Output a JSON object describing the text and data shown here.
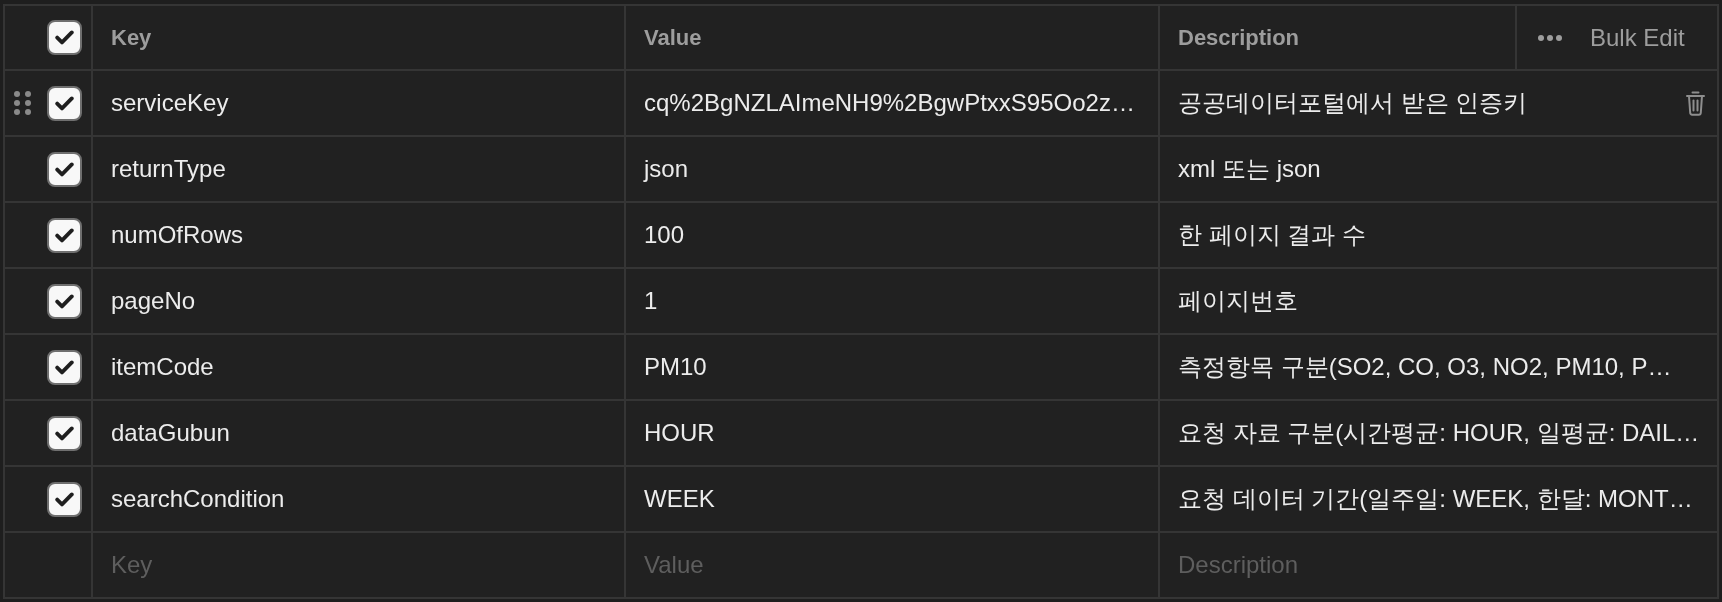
{
  "header": {
    "checkbox": {
      "checked": true
    },
    "columns": [
      "Key",
      "Value",
      "Description"
    ],
    "bulk_edit": "Bulk Edit"
  },
  "rows": [
    {
      "checked": true,
      "hovered": true,
      "key": "serviceKey",
      "value": "cq%2BgNZLAImeNH9%2BgwPtxxS95Oo2z…",
      "description": "공공데이터포털에서 받은 인증키"
    },
    {
      "checked": true,
      "hovered": false,
      "key": "returnType",
      "value": "json",
      "description": "xml 또는 json"
    },
    {
      "checked": true,
      "hovered": false,
      "key": "numOfRows",
      "value": "100",
      "description": "한 페이지 결과 수"
    },
    {
      "checked": true,
      "hovered": false,
      "key": "pageNo",
      "value": "1",
      "description": "페이지번호"
    },
    {
      "checked": true,
      "hovered": false,
      "key": "itemCode",
      "value": "PM10",
      "description": "측정항목 구분(SO2, CO, O3, NO2, PM10, P…"
    },
    {
      "checked": true,
      "hovered": false,
      "key": "dataGubun",
      "value": "HOUR",
      "description": "요청 자료 구분(시간평균: HOUR, 일평균: DAIL…"
    },
    {
      "checked": true,
      "hovered": false,
      "key": "searchCondition",
      "value": "WEEK",
      "description": "요청 데이터 기간(일주일: WEEK, 한달: MONT…"
    }
  ],
  "new_row": {
    "key": {
      "placeholder": "Key"
    },
    "value": {
      "placeholder": "Value"
    },
    "description": {
      "placeholder": "Description"
    }
  }
}
